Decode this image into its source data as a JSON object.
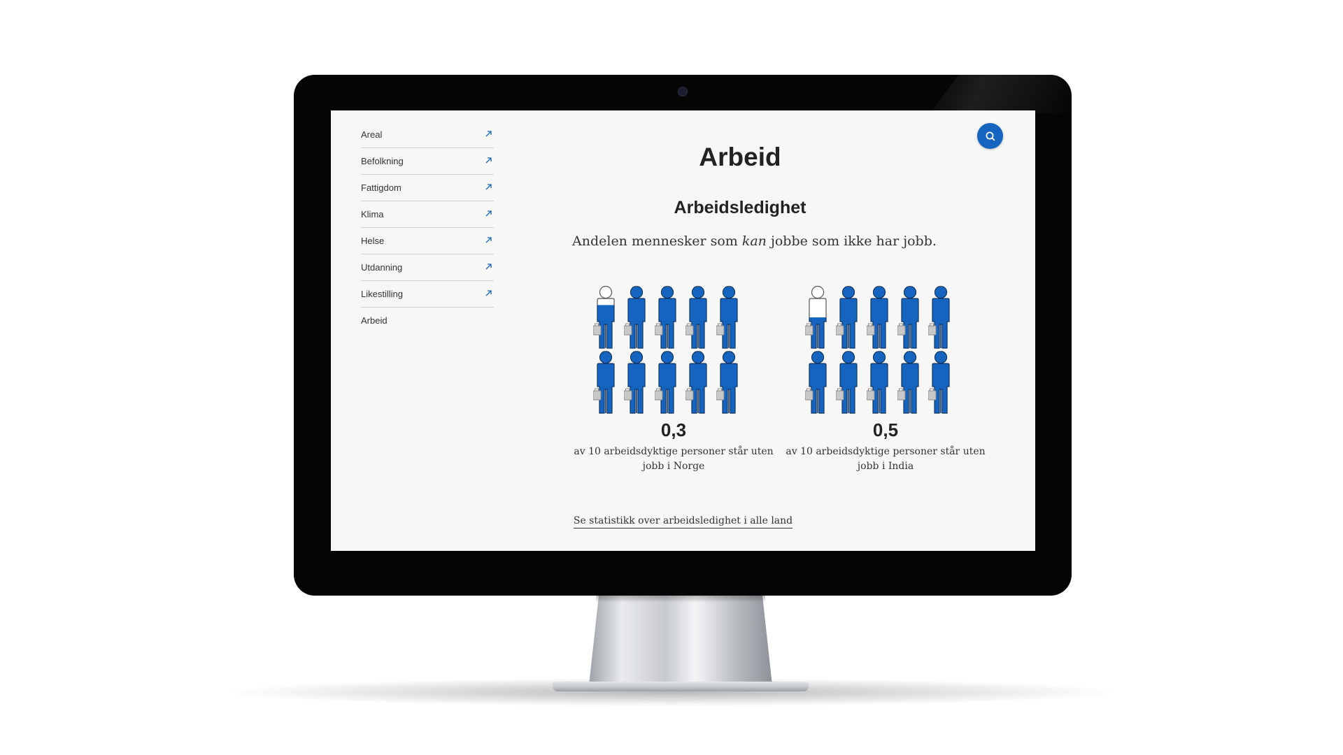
{
  "sidebar": {
    "items": [
      {
        "label": "Areal",
        "has_link_icon": true
      },
      {
        "label": "Befolkning",
        "has_link_icon": true
      },
      {
        "label": "Fattigdom",
        "has_link_icon": true
      },
      {
        "label": "Klima",
        "has_link_icon": true
      },
      {
        "label": "Helse",
        "has_link_icon": true
      },
      {
        "label": "Utdanning",
        "has_link_icon": true
      },
      {
        "label": "Likestilling",
        "has_link_icon": true
      },
      {
        "label": "Arbeid",
        "has_link_icon": false
      }
    ]
  },
  "header": {
    "search_icon": "search-icon"
  },
  "main": {
    "title": "Arbeid",
    "section_title": "Arbeidsledighet",
    "intro_before": "Andelen mennesker som ",
    "intro_emphasis": "kan",
    "intro_after": " jobbe som ikke har jobb."
  },
  "stats": [
    {
      "value": "0,3",
      "unemployed_fraction": 0.3,
      "people_total": 10,
      "caption_line1": "av 10 arbeidsdyktige personer står uten",
      "caption_line2": "jobb i Norge"
    },
    {
      "value": "0,5",
      "unemployed_fraction": 0.5,
      "people_total": 10,
      "caption_line1": "av 10 arbeidsdyktige personer står uten",
      "caption_line2": "jobb i India"
    }
  ],
  "footer": {
    "link_text": "Se statistikk over arbeidsledighet i alle land"
  },
  "colors": {
    "accent": "#1565c0",
    "person_fill": "#1565c0",
    "person_dark": "#0b2e5c",
    "briefcase": "#c8c8c8",
    "screen_bg": "#f7f7f5",
    "bezel": "#050505"
  }
}
